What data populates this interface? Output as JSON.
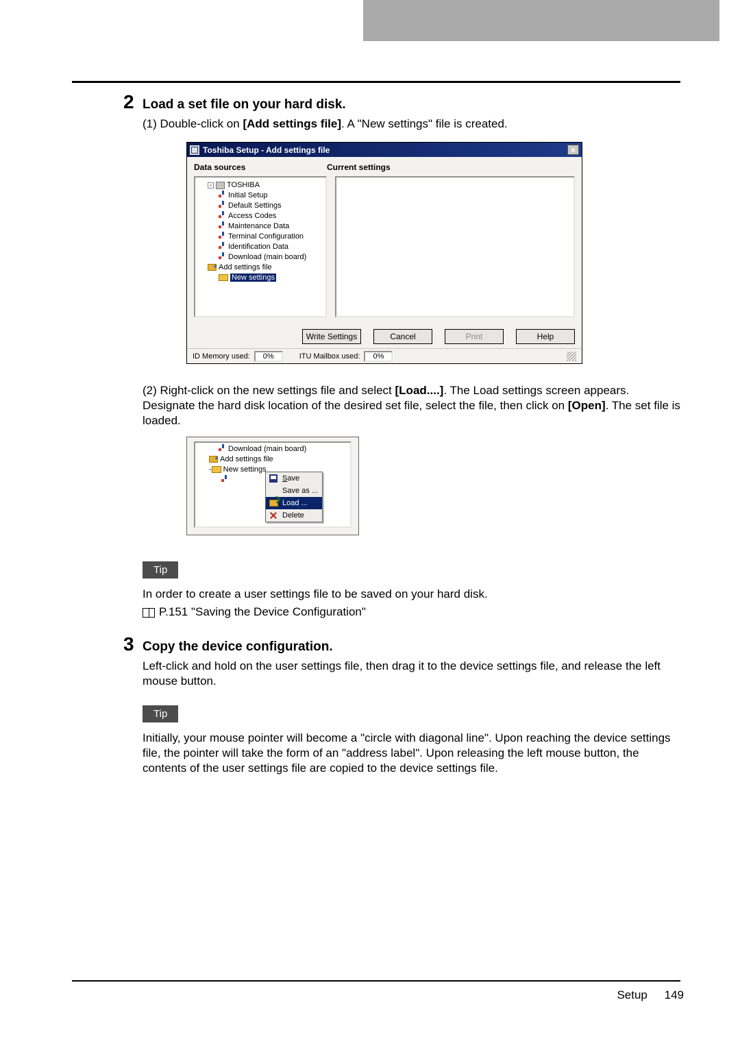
{
  "step2": {
    "title": "Load a set file on your hard disk.",
    "p1_prefix": "(1) Double-click on ",
    "p1_bold": "[Add settings file]",
    "p1_suffix": ". A \"New settings\" file is created.",
    "p2_prefix": "(2) Right-click on the new settings file and select ",
    "p2_bold": "[Load....]",
    "p2_mid": ". The Load settings screen appears. Designate the hard disk location of the desired set file, select the file, then click on ",
    "p2_bold2": "[Open]",
    "p2_suffix": ". The set file is loaded."
  },
  "shot1": {
    "title": "Toshiba Setup - Add settings file",
    "ds_label": "Data sources",
    "cs_label": "Current settings",
    "tree": {
      "root": "TOSHIBA",
      "items": [
        "Initial Setup",
        "Default Settings",
        "Access Codes",
        "Maintenance Data",
        "Terminal Configuration",
        "Identification Data",
        "Download (main board)"
      ],
      "add_file": "Add settings file",
      "new_settings": "New settings"
    },
    "buttons": {
      "write": "Write Settings",
      "cancel": "Cancel",
      "print": "Print",
      "help": "Help"
    },
    "status": {
      "id_label": "ID Memory used:",
      "id_val": "0%",
      "itu_label": "ITU Mailbox used:",
      "itu_val": "0%"
    }
  },
  "shot2": {
    "tree": {
      "download": "Download (main board)",
      "add_file": "Add settings file",
      "new_settings": "New settings"
    },
    "menu": {
      "save": "Save",
      "saveas": "Save as ...",
      "load": "Load ...",
      "delete": "Delete"
    }
  },
  "tip_label": "Tip",
  "tip1_line": "In order to create a user settings file to be saved on your hard disk.",
  "tip1_ref": "P.151 \"Saving the Device Configuration\"",
  "step3": {
    "title": "Copy the device configuration.",
    "body": "Left-click and hold on the user settings file, then drag it to the device settings file, and release the left mouse button."
  },
  "tip2_body": "Initially, your mouse pointer will become a \"circle with diagonal line\". Upon reaching the device settings file, the pointer will take the form of an \"address label\". Upon releasing the left mouse button, the contents of the user settings file are copied to the device settings file.",
  "footer": {
    "section": "Setup",
    "page": "149"
  },
  "step_nums": {
    "s2": "2",
    "s3": "3"
  }
}
